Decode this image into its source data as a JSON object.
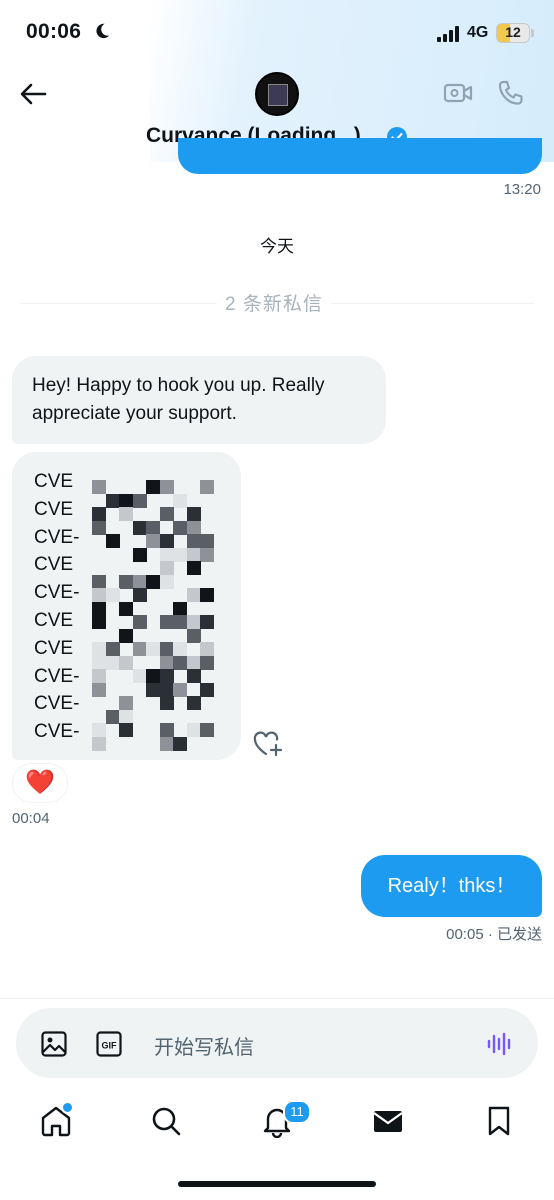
{
  "status_bar": {
    "time": "00:06",
    "network": "4G",
    "battery": "12"
  },
  "header": {
    "contact_name": "Curvance (Loading...)",
    "back_icon": "arrow-left-icon",
    "video_icon": "video-call-icon",
    "phone_icon": "phone-icon",
    "verified_icon": "verified-badge-icon"
  },
  "conversation": {
    "prev_timestamp": "13:20",
    "date_divider": "今天",
    "new_messages_divider": "2 条新私信",
    "incoming_message_1": "Hey! Happy to hook you up. Really appreciate your support.",
    "incoming_message_2_lines": [
      "CVE",
      "CVE",
      "CVE-",
      "CVE",
      "CVE-",
      "CVE",
      "CVE",
      "CVE-",
      "CVE-",
      "CVE-"
    ],
    "reaction_emoji": "❤️",
    "incoming_timestamp": "00:04",
    "outgoing_message": "Realy！thks！",
    "outgoing_status": "00:05 · 已发送"
  },
  "composer": {
    "placeholder": "开始写私信",
    "image_icon": "image-icon",
    "gif_icon": "gif-icon",
    "voice_icon": "voice-wave-icon"
  },
  "tab_bar": {
    "notifications_badge": "11",
    "tabs": [
      "home-icon",
      "search-icon",
      "bell-icon",
      "mail-icon",
      "bookmark-icon"
    ]
  },
  "colors": {
    "accent": "#1d9bf0",
    "bubble_in": "#eff3f4",
    "text": "#0f1419",
    "muted": "#536471",
    "voice": "#7856ff"
  }
}
